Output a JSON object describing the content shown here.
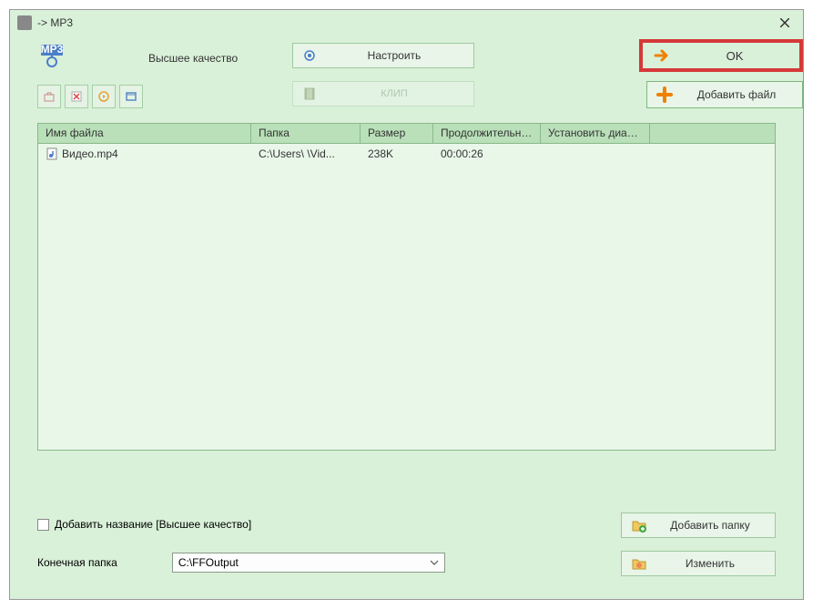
{
  "window": {
    "title": " ->  MP3"
  },
  "top": {
    "quality_label": "Высшее качество",
    "configure_label": "Настроить",
    "ok_label": "OK",
    "clip_label": "КЛИП",
    "addfile_label": "Добавить файл"
  },
  "table": {
    "headers": {
      "filename": "Имя файла",
      "folder": "Папка",
      "size": "Размер",
      "duration": "Продолжительность",
      "setrange": "Установить диапа…"
    },
    "rows": [
      {
        "filename": "Видео.mp4",
        "folder": "C:\\Users\\        \\Vid...",
        "size": "238K",
        "duration": "00:00:26",
        "setrange": ""
      }
    ]
  },
  "bottom": {
    "checkbox_label": "Добавить название [Высшее качество]",
    "addfolder_label": "Добавить папку",
    "change_label": "Изменить",
    "dest_label": "Конечная папка",
    "dest_value": "C:\\FFOutput"
  },
  "icons": {
    "mp3": "mp3-icon",
    "gear": "gear-icon",
    "arrow": "arrow-icon",
    "plus": "plus-icon",
    "folder_add": "folder-add-icon",
    "folder_edit": "folder-edit-icon",
    "film": "film-icon",
    "open": "open-icon",
    "delete": "delete-icon",
    "play": "play-icon",
    "window": "window-icon"
  }
}
